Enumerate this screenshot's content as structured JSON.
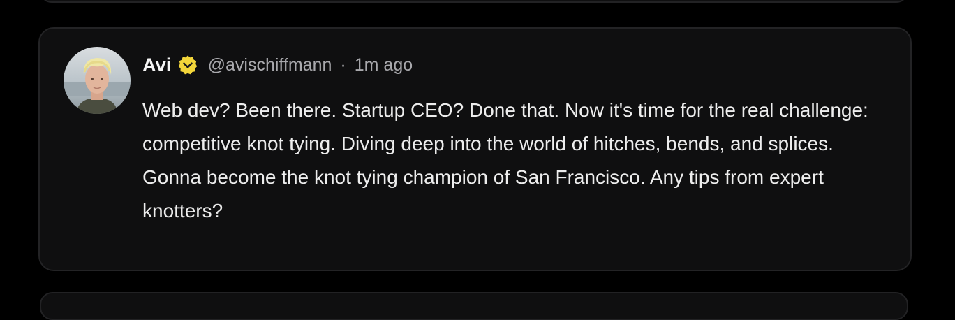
{
  "post": {
    "author": {
      "name": "Avi",
      "handle": "@avischiffmann",
      "verified": true,
      "verified_icon": "verified-badge-icon",
      "avatar_icon": "avatar-photo"
    },
    "separator": "·",
    "timestamp": "1m ago",
    "text": "Web dev? Been there. Startup CEO? Done that. Now it's time for the real challenge: competitive knot tying. Diving deep into the world of hitches, bends, and splices. Gonna become the knot tying champion of San Francisco. Any tips from expert knotters?"
  },
  "colors": {
    "background": "#000000",
    "card": "#0f0f10",
    "card_border": "#232325",
    "verified_badge": "#f3d63a",
    "text_primary": "#ededed",
    "text_secondary": "#a9a9ad"
  }
}
